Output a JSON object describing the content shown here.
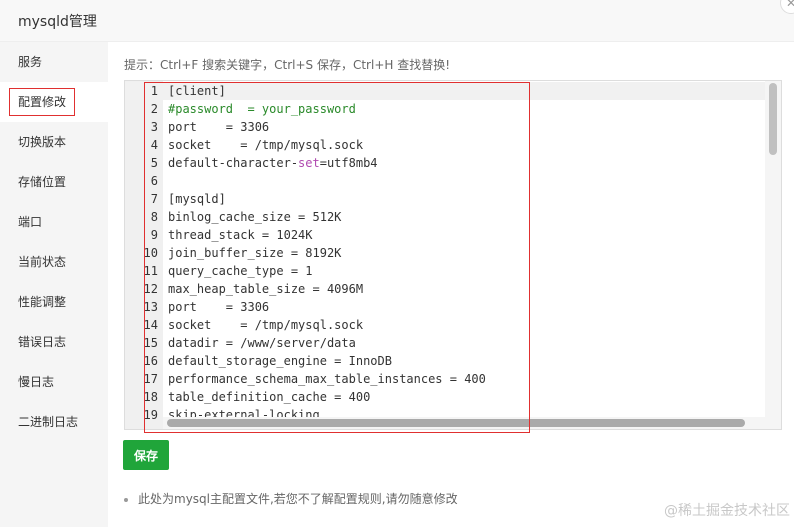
{
  "window": {
    "title": "mysqld管理",
    "close_symbol": "✕"
  },
  "sidebar": {
    "items": [
      {
        "label": "服务"
      },
      {
        "label": "配置修改"
      },
      {
        "label": "切换版本"
      },
      {
        "label": "存储位置"
      },
      {
        "label": "端口"
      },
      {
        "label": "当前状态"
      },
      {
        "label": "性能调整"
      },
      {
        "label": "错误日志"
      },
      {
        "label": "慢日志"
      },
      {
        "label": "二进制日志"
      }
    ],
    "active_index": 1
  },
  "hint": "提示：Ctrl+F 搜索关键字，Ctrl+S 保存，Ctrl+H 查找替换!",
  "editor": {
    "lines": [
      "[client]",
      "#password  = your_password",
      "port    = 3306",
      "socket    = /tmp/mysql.sock",
      "default-character-set=utf8mb4",
      "",
      "[mysqld]",
      "binlog_cache_size = 512K",
      "thread_stack = 1024K",
      "join_buffer_size = 8192K",
      "query_cache_type = 1",
      "max_heap_table_size = 4096M",
      "port    = 3306",
      "socket    = /tmp/mysql.sock",
      "datadir = /www/server/data",
      "default_storage_engine = InnoDB",
      "performance_schema_max_table_instances = 400",
      "table_definition_cache = 400",
      "skip-external-locking"
    ],
    "comment_color": "#2a8a2a"
  },
  "save_button": {
    "label": "保存",
    "color": "#20a53a"
  },
  "note": "此处为mysql主配置文件,若您不了解配置规则,请勿随意修改",
  "watermark": "@稀土掘金技术社区"
}
